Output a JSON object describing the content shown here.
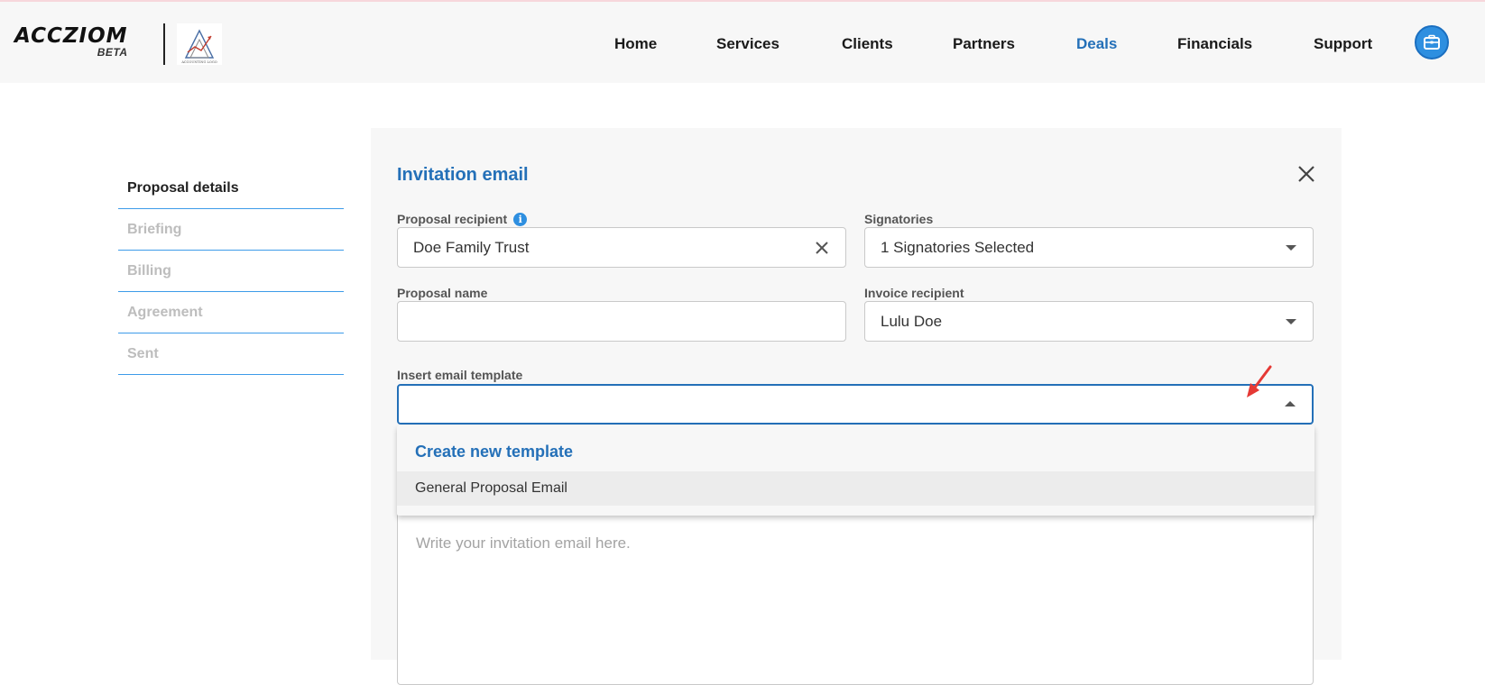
{
  "colors": {
    "accent": "#2470b8",
    "annotation_arrow": "#e53935"
  },
  "brand": {
    "name": "ACCZIOM",
    "tag": "BETA",
    "partner_logo_text": "ACCOUNTING LOGO"
  },
  "nav": {
    "items": [
      {
        "label": "Home",
        "active": false
      },
      {
        "label": "Services",
        "active": false
      },
      {
        "label": "Clients",
        "active": false
      },
      {
        "label": "Partners",
        "active": false
      },
      {
        "label": "Deals",
        "active": true
      },
      {
        "label": "Financials",
        "active": false
      },
      {
        "label": "Support",
        "active": false
      }
    ],
    "user_icon": "briefcase-icon"
  },
  "sidebar": {
    "steps": [
      {
        "label": "Proposal details",
        "current": true
      },
      {
        "label": "Briefing",
        "current": false
      },
      {
        "label": "Billing",
        "current": false
      },
      {
        "label": "Agreement",
        "current": false
      },
      {
        "label": "Sent",
        "current": false
      }
    ]
  },
  "form": {
    "title": "Invitation email",
    "proposal_recipient": {
      "label": "Proposal recipient",
      "value": "Doe Family Trust"
    },
    "signatories": {
      "label": "Signatories",
      "value": "1 Signatories Selected"
    },
    "proposal_name": {
      "label": "Proposal name",
      "value": ""
    },
    "invoice_recipient": {
      "label": "Invoice recipient",
      "value": "Lulu Doe"
    },
    "email_template": {
      "label": "Insert email template",
      "value": "",
      "dropdown": {
        "create_label": "Create new template",
        "options": [
          "General Proposal Email"
        ]
      }
    },
    "email_body": {
      "placeholder": "Write your invitation email here."
    }
  }
}
